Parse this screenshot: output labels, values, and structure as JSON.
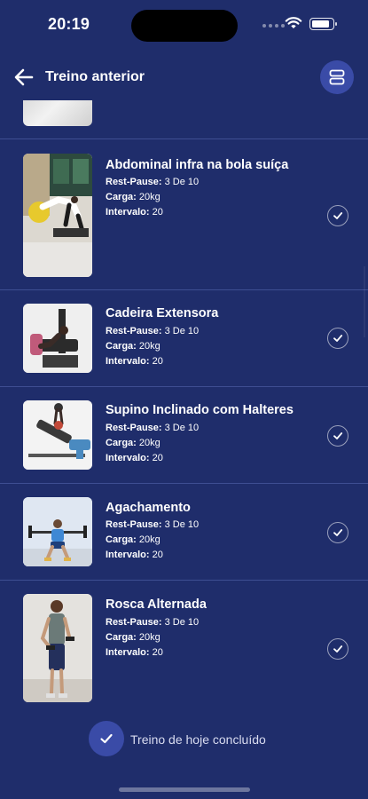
{
  "status_bar": {
    "time": "20:19",
    "battery_level": 0.92
  },
  "header": {
    "title": "Treino anterior",
    "back_icon": "arrow-left-icon",
    "layout_icon": "layout-stack-icon"
  },
  "colors": {
    "background": "#1f2d6b",
    "accent": "#3a4ba7",
    "divider": "#3b4a8f"
  },
  "exercises": [
    {
      "name": "Abdominal infra na bola suíça",
      "lines": [
        {
          "label": "Rest-Pause:",
          "value": " 3 De 10"
        },
        {
          "label": "Carga:",
          "value": " 20kg"
        },
        {
          "label": "Intervalo:",
          "value": " 20"
        }
      ],
      "completed": true
    },
    {
      "name": "Cadeira Extensora",
      "lines": [
        {
          "label": "Rest-Pause:",
          "value": " 3 De 10"
        },
        {
          "label": "Carga:",
          "value": " 20kg"
        },
        {
          "label": "Intervalo:",
          "value": " 20"
        }
      ],
      "completed": true
    },
    {
      "name": "Supino Inclinado com Halteres",
      "lines": [
        {
          "label": "Rest-Pause:",
          "value": " 3 De 10"
        },
        {
          "label": "Carga:",
          "value": " 20kg"
        },
        {
          "label": "Intervalo:",
          "value": " 20"
        }
      ],
      "completed": true
    },
    {
      "name": "Agachamento",
      "lines": [
        {
          "label": "Rest-Pause:",
          "value": " 3 De 10"
        },
        {
          "label": "Carga:",
          "value": " 20kg"
        },
        {
          "label": "Intervalo:",
          "value": " 20"
        }
      ],
      "completed": true
    },
    {
      "name": "Rosca Alternada",
      "lines": [
        {
          "label": "Rest-Pause:",
          "value": " 3 De 10"
        },
        {
          "label": "Carga:",
          "value": " 20kg"
        },
        {
          "label": "Intervalo:",
          "value": " 20"
        }
      ],
      "completed": true
    }
  ],
  "footer": {
    "label": "Treino de hoje concluído",
    "icon": "check-icon"
  }
}
